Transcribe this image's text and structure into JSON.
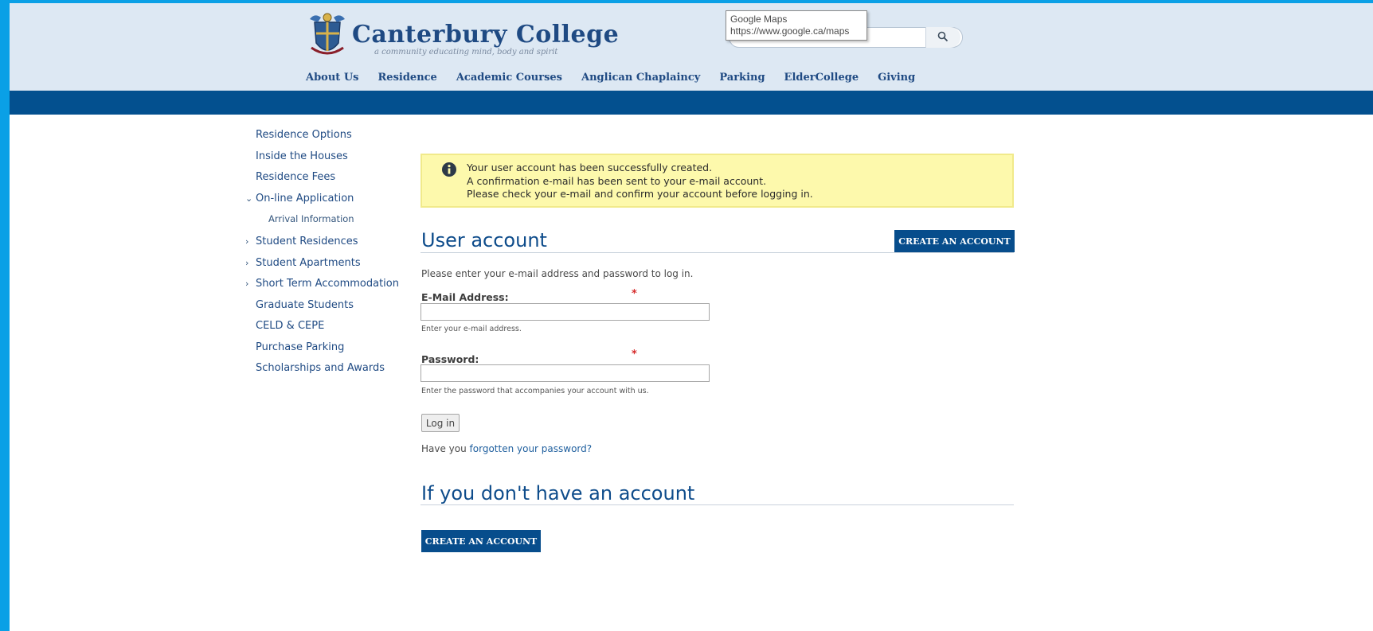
{
  "header": {
    "site_title": "Canterbury College",
    "tagline": "a community educating mind, body and spirit",
    "tooltip": {
      "title": "Google Maps",
      "url": "https://www.google.ca/maps"
    },
    "search_icon": "search-icon",
    "nav": [
      "About Us",
      "Residence",
      "Academic Courses",
      "Anglican Chaplaincy",
      "Parking",
      "ElderCollege",
      "Giving"
    ]
  },
  "sidebar": {
    "items": [
      {
        "label": "Residence Options",
        "marker": ""
      },
      {
        "label": "Inside the Houses",
        "marker": ""
      },
      {
        "label": "Residence Fees",
        "marker": ""
      },
      {
        "label": "On-line Application",
        "marker": "⌄"
      },
      {
        "label": "Arrival Information",
        "marker": ""
      },
      {
        "label": "Student Residences",
        "marker": "›"
      },
      {
        "label": "Student Apartments",
        "marker": "›"
      },
      {
        "label": "Short Term Accommodation",
        "marker": "›"
      },
      {
        "label": "Graduate Students",
        "marker": ""
      },
      {
        "label": "CELD & CEPE",
        "marker": ""
      },
      {
        "label": "Purchase Parking",
        "marker": ""
      },
      {
        "label": "Scholarships and Awards",
        "marker": ""
      }
    ]
  },
  "alert": {
    "icon": "info-icon",
    "lines": [
      "Your user account has been successfully created.",
      "A confirmation e-mail has been sent to your e-mail account.",
      "Please check your e-mail and confirm your account before logging in."
    ]
  },
  "login": {
    "title": "User account",
    "create_account_label": "CREATE AN ACCOUNT",
    "intro": "Please enter your e-mail address and password to log in.",
    "email": {
      "label": "E-Mail Address:",
      "required_mark": "*",
      "value": "",
      "help": "Enter your e-mail address."
    },
    "password": {
      "label": "Password:",
      "required_mark": "*",
      "value": "",
      "help": "Enter the password that accompanies your account with us."
    },
    "login_button": "Log in",
    "forgot_prefix": "Have you ",
    "forgot_link": "forgotten your password?"
  },
  "no_account": {
    "title": "If you don't have an account",
    "create_account_label": "CREATE AN ACCOUNT"
  },
  "colors": {
    "page_frame": "#0aa0e6",
    "brand_blue": "#03508f",
    "header_bg": "#dde8f3",
    "alert_bg": "#fdf9ac",
    "required": "#d62a2a"
  }
}
